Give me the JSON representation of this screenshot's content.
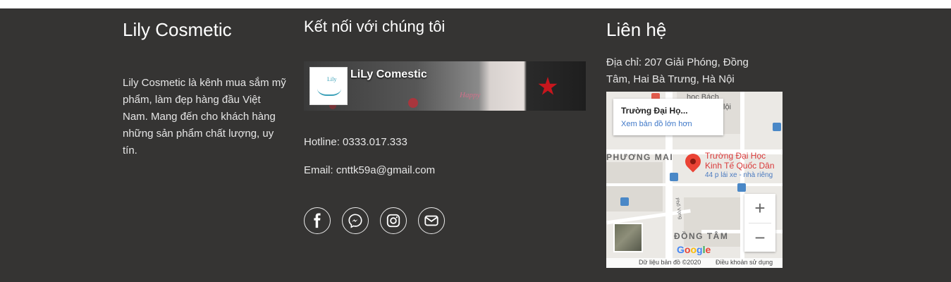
{
  "brand": {
    "title": "Lily Cosmetic",
    "description": "Lily Cosmetic là kênh mua sắm mỹ phẩm, làm đẹp hàng đầu Việt Nam. Mang đến cho khách hàng những sản phẩm chất lượng, uy tín."
  },
  "connect": {
    "title": "Kết nối với chúng tôi",
    "fb_page_name": "LiLy Comestic",
    "logo_text": "Lily",
    "card_text": "Happy",
    "hotline": "Hotline: 0333.017.333",
    "email": "Email: cnttk59a@gmail.com",
    "social": [
      "facebook-icon",
      "messenger-icon",
      "instagram-icon",
      "mail-icon"
    ]
  },
  "contact": {
    "title": "Liên hệ",
    "address": "Địa chỉ: 207 Giải Phóng, Đồng Tâm, Hai Bà Trưng, Hà Nội"
  },
  "map": {
    "place_title": "Trường Đại Họ...",
    "view_larger": "Xem bản đồ lớn hơn",
    "pin_line1": "Trường Đại Học",
    "pin_line2": "Kinh Tế Quốc Dân",
    "pin_sub": "44 p lái xe - nhà riêng",
    "area1": "PHƯƠNG MAI",
    "area2": "ĐỒNG TÂM",
    "poi_top": "học Bách",
    "poi_right": "lội",
    "street": "Phố Vọng",
    "google": "Google",
    "attribution": "Dữ liệu bản đồ ©2020",
    "terms": "Điều khoản sử dụng",
    "zoom_in": "+",
    "zoom_out": "−"
  },
  "colors": {
    "footer_bg": "#353433",
    "link_blue": "#3f78c8",
    "pin_red": "#ea4335"
  }
}
